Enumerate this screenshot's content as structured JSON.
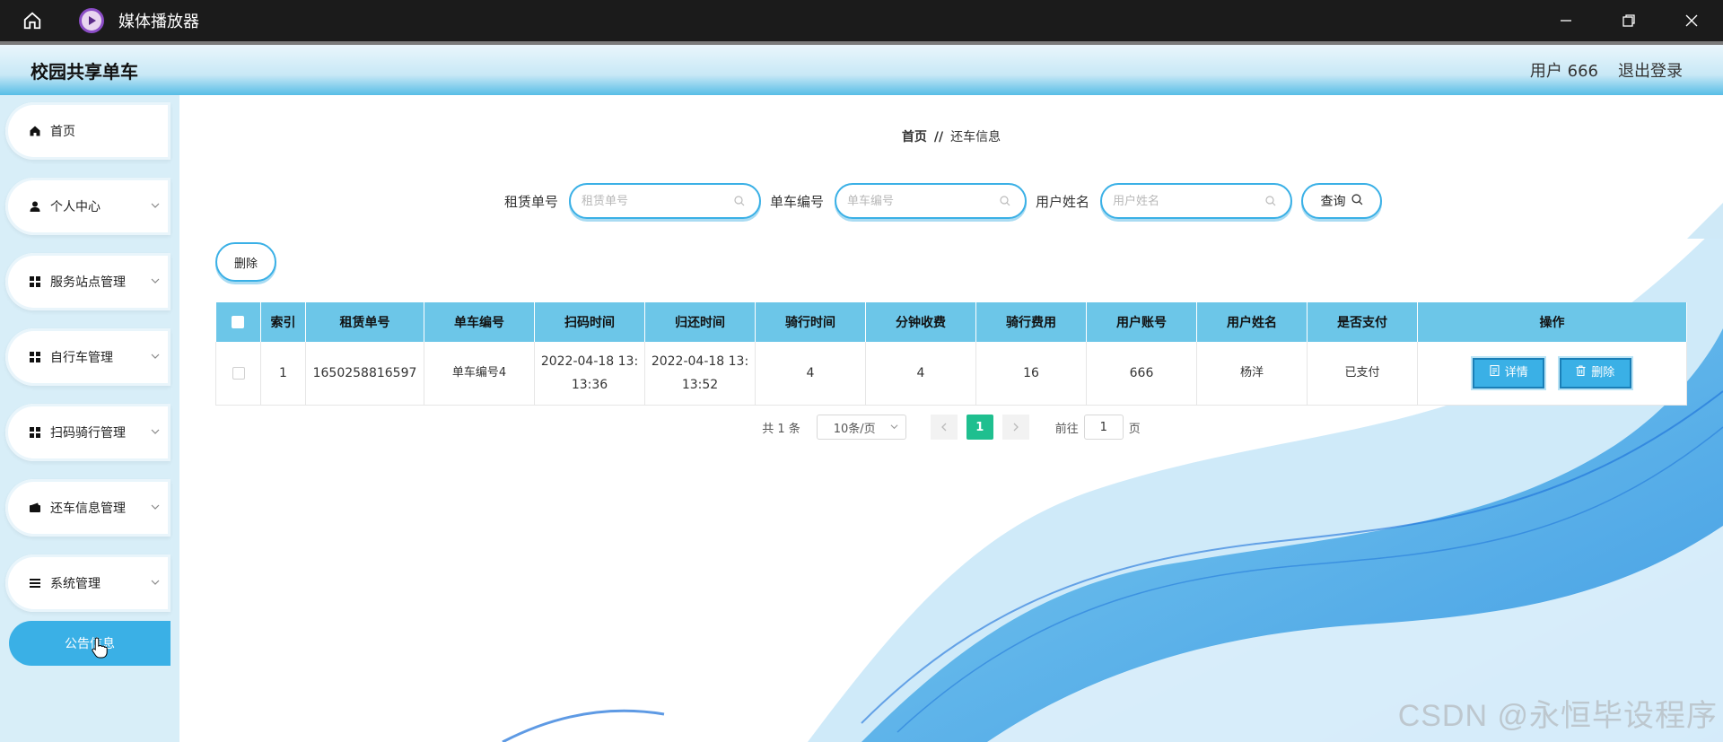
{
  "window": {
    "title": "媒体播放器"
  },
  "header": {
    "brand": "校园共享单车",
    "user": "用户 666",
    "logout": "退出登录"
  },
  "sidebar": {
    "items": [
      {
        "label": "首页",
        "icon": "home-icon"
      },
      {
        "label": "个人中心",
        "icon": "user-icon"
      },
      {
        "label": "服务站点管理",
        "icon": "grid-icon"
      },
      {
        "label": "自行车管理",
        "icon": "grid-icon"
      },
      {
        "label": "扫码骑行管理",
        "icon": "grid-icon"
      },
      {
        "label": "还车信息管理",
        "icon": "wallet-icon"
      },
      {
        "label": "系统管理",
        "icon": "list-icon"
      },
      {
        "label": "公告信息",
        "icon": ""
      }
    ]
  },
  "breadcrumb": {
    "home": "首页",
    "sep": "//",
    "current": "还车信息"
  },
  "search": {
    "f1_label": "租赁单号",
    "f1_placeholder": "租赁单号",
    "f2_label": "单车编号",
    "f2_placeholder": "单车编号",
    "f3_label": "用户姓名",
    "f3_placeholder": "用户姓名",
    "query": "查询"
  },
  "toolbar": {
    "delete": "删除"
  },
  "table": {
    "headers": [
      "索引",
      "租赁单号",
      "单车编号",
      "扫码时间",
      "归还时间",
      "骑行时间",
      "分钟收费",
      "骑行费用",
      "用户账号",
      "用户姓名",
      "是否支付",
      "操作"
    ],
    "rows": [
      {
        "index": "1",
        "order_no": "1650258816597",
        "bike_no": "单车编号4",
        "scan_time_a": "2022-04-18 13:",
        "scan_time_b": "13:36",
        "return_time_a": "2022-04-18 13:",
        "return_time_b": "13:52",
        "ride_time": "4",
        "per_min": "4",
        "fee": "16",
        "account": "666",
        "name": "杨洋",
        "paid": "已支付",
        "detail": "详情",
        "delete": "删除"
      }
    ]
  },
  "pager": {
    "total": "共 1 条",
    "size": "10条/页",
    "current": "1",
    "goto": "前往",
    "goto_value": "1",
    "page": "页"
  },
  "watermark": "CSDN @永恒毕设程序",
  "colors": {
    "accent": "#3ab0e6",
    "header_th": "#6cc6e8",
    "page_current": "#1fbf8f",
    "titlebar": "#1b1b1b"
  }
}
